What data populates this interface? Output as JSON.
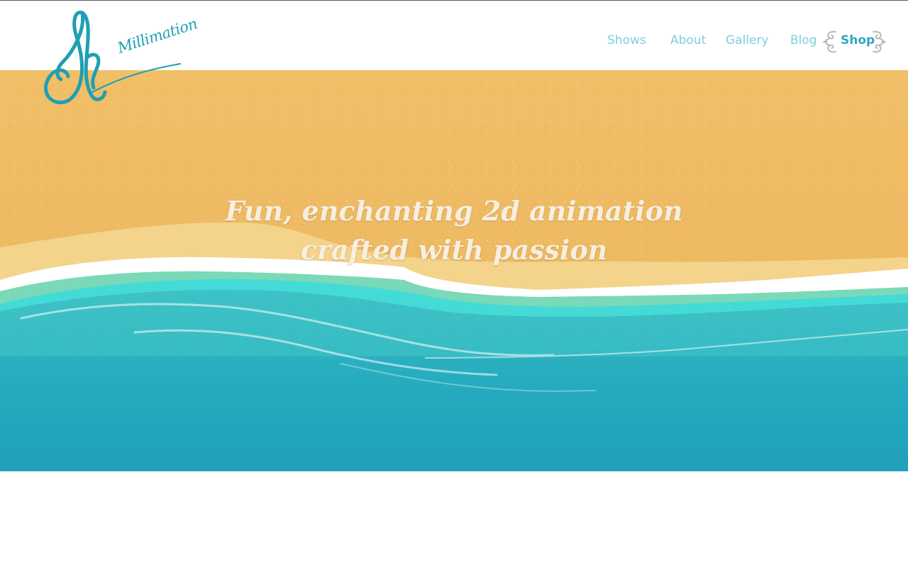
{
  "brand": {
    "name": "Millimation",
    "colors": {
      "accent": "#2ea9c0",
      "nav": "#7ccfe0",
      "sand": "#efb95e",
      "sea": "#22a6bc",
      "foam": "#ffffff",
      "hero_text": "#f6efe1"
    }
  },
  "nav": {
    "items": [
      {
        "label": "Shows"
      },
      {
        "label": "About"
      },
      {
        "label": "Gallery"
      },
      {
        "label": "Blog"
      },
      {
        "label": "Shop",
        "active": true
      }
    ],
    "decor_icon": "swirl-ornament-icon"
  },
  "hero": {
    "line1": "Fun, enchanting 2d animation",
    "line2": "crafted with passion"
  }
}
